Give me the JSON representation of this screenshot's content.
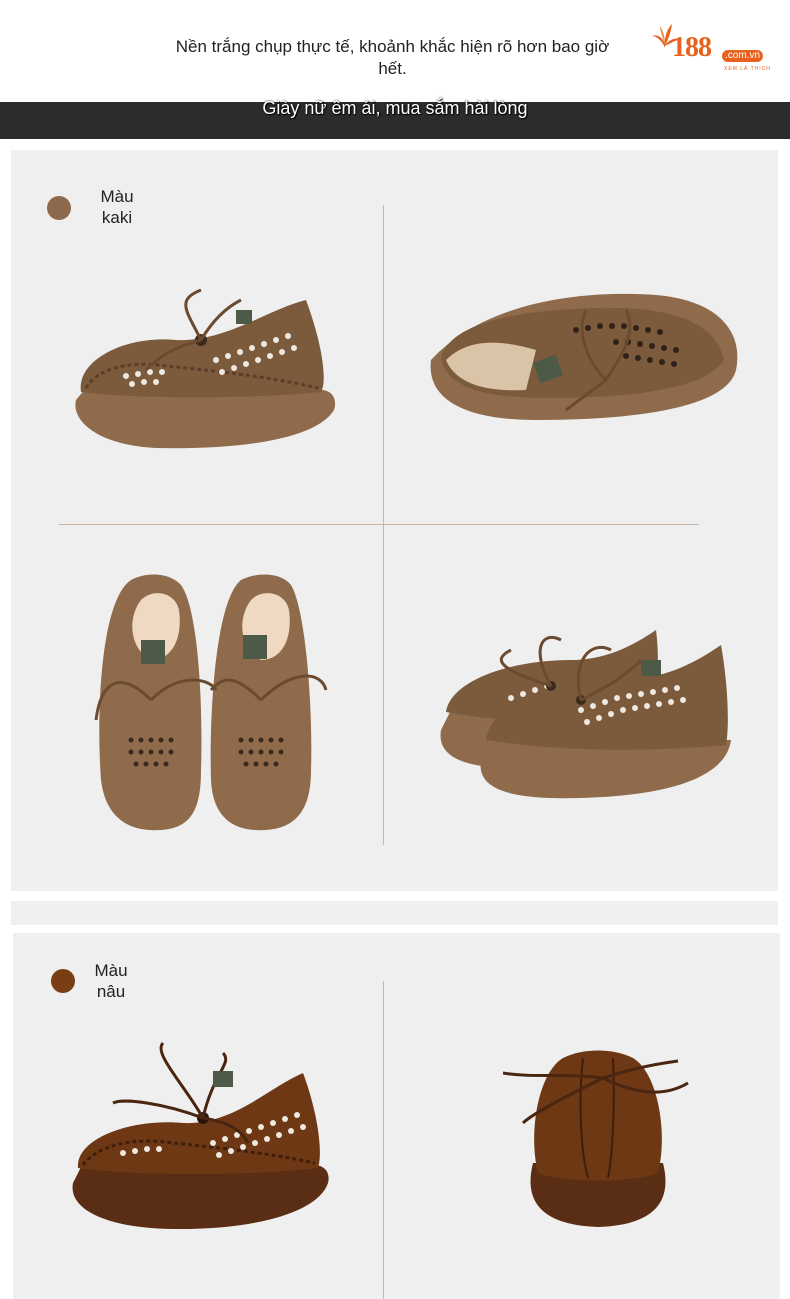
{
  "header": {
    "caption": "Nền trắng chụp thực tế, khoảnh khắc hiện rõ hơn bao giờ hết.",
    "logo_number": "188",
    "logo_domain": ".com.vn",
    "logo_tagline": "XEM LÀ THÍCH"
  },
  "banner": {
    "text": "Giày nữ êm ái, mua sắm hài lòng"
  },
  "colors": {
    "khaki": "#8b6a4f",
    "brown": "#7a3e14",
    "accent": "#e8621f",
    "banner_bg": "#2b2c2e",
    "panel_bg": "#efefef"
  },
  "variants": [
    {
      "label": "Màu kaki",
      "swatch_color": "#8b6a4f"
    },
    {
      "label": "Màu nâu",
      "swatch_color": "#7a3e14"
    }
  ]
}
